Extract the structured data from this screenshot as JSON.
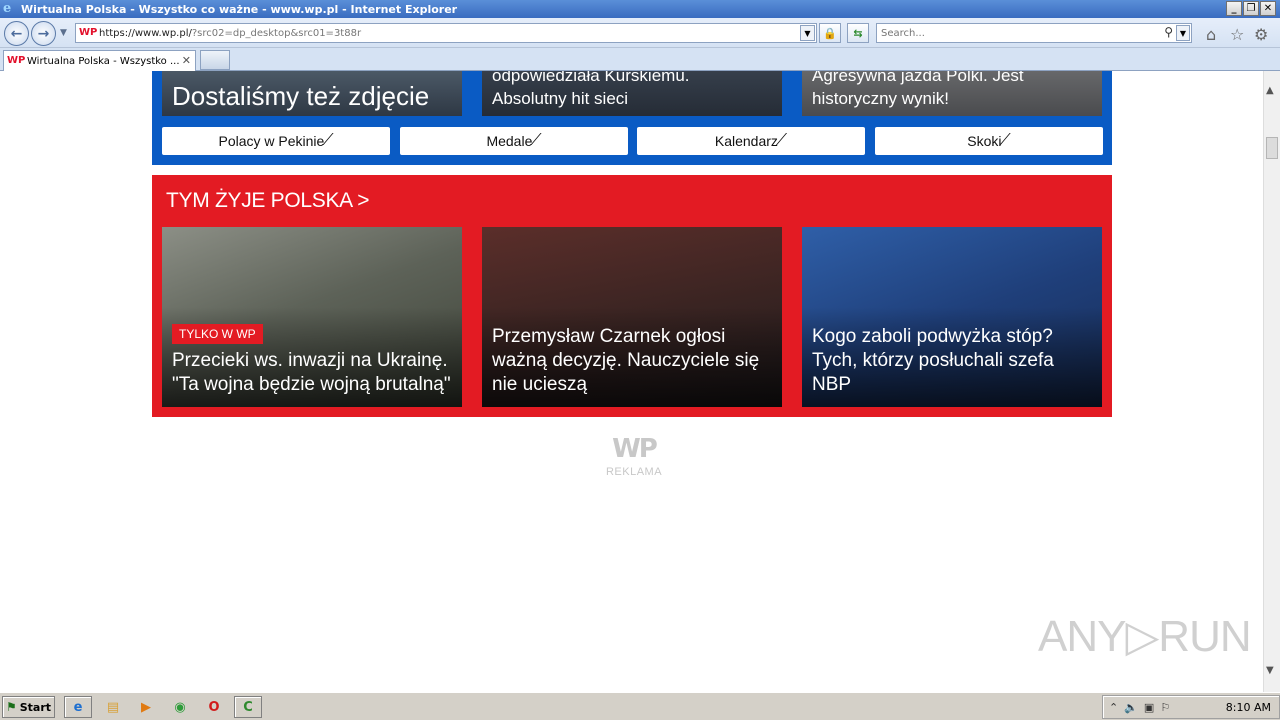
{
  "window": {
    "title": "Wirtualna Polska - Wszystko co ważne - www.wp.pl - Internet Explorer",
    "minimize": "_",
    "restore": "❐",
    "close": "✕"
  },
  "address_bar": {
    "url_main": "https://www.wp.pl/",
    "url_rest": "?src02=dp_desktop&src01=3t88r",
    "favicon": "WP"
  },
  "search": {
    "placeholder": "Search..."
  },
  "tabs": [
    {
      "label": "Wirtualna Polska - Wszystko ...",
      "favicon": "WP"
    }
  ],
  "blue_section": {
    "cards": [
      {
        "title": "Dostaliśmy też zdjęcie"
      },
      {
        "title": "odpowiedziała Kurskiemu. Absolutny hit sieci"
      },
      {
        "title": "Agresywna jazda Polki. Jest historyczny wynik!"
      }
    ],
    "links": [
      {
        "label": "Polacy w Pekinie"
      },
      {
        "label": "Medale"
      },
      {
        "label": "Kalendarz"
      },
      {
        "label": "Skoki"
      }
    ]
  },
  "red_section": {
    "heading": "TYM ŻYJE POLSKA >",
    "cards": [
      {
        "badge": "TYLKO W WP",
        "title": "Przecieki ws. inwazji na Ukrainę. \"Ta wojna będzie wojną brutalną\""
      },
      {
        "title": "Przemysław Czarnek ogłosi ważną decyzję. Nauczyciele się nie ucieszą"
      },
      {
        "title": "Kogo zaboli podwyżka stóp? Tych, którzy posłuchali szefa NBP"
      }
    ]
  },
  "ad": {
    "logo": "WP",
    "label": "REKLAMA"
  },
  "watermark": "ANY▷RUN",
  "taskbar": {
    "start": "Start",
    "clock": "8:10 AM"
  },
  "colors": {
    "wp_red": "#e31b23",
    "wp_blue": "#0a5bc4"
  }
}
